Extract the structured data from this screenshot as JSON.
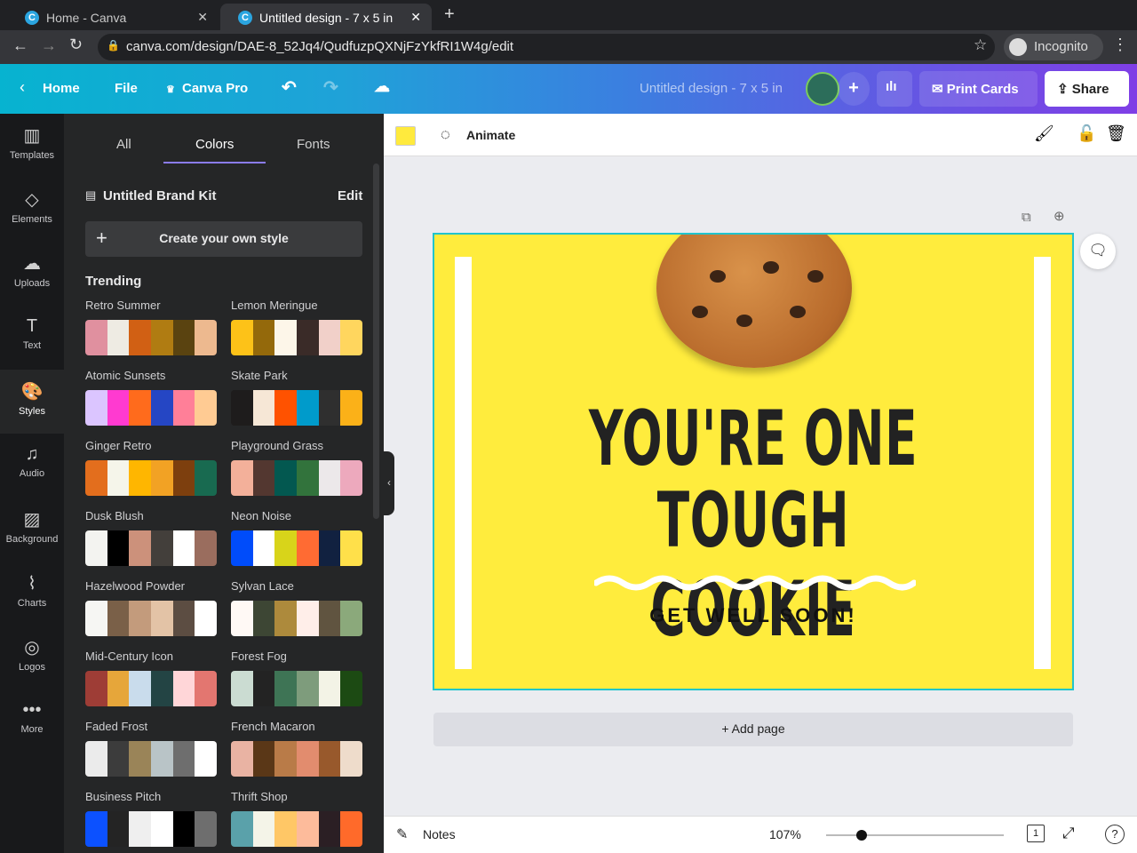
{
  "browser": {
    "tabs": [
      {
        "title": "Home - Canva"
      },
      {
        "title": "Untitled design - 7 x 5 in"
      }
    ],
    "new_tab": "+",
    "url": "canva.com/design/DAE-8_52Jq4/QudfuzpQXNjFzYkfRI1W4g/edit",
    "profile": "Incognito"
  },
  "header": {
    "home": "Home",
    "file": "File",
    "canva_pro": "Canva Pro",
    "design_title": "Untitled design - 7 x 5 in",
    "print": "Print Cards",
    "share": "Share"
  },
  "rail": [
    {
      "label": "Templates",
      "icon": "▥"
    },
    {
      "label": "Elements",
      "icon": "◇"
    },
    {
      "label": "Uploads",
      "icon": "☁"
    },
    {
      "label": "Text",
      "icon": "T"
    },
    {
      "label": "Styles",
      "icon": "🎨"
    },
    {
      "label": "Audio",
      "icon": "♫"
    },
    {
      "label": "Background",
      "icon": "▨"
    },
    {
      "label": "Charts",
      "icon": "⌇"
    },
    {
      "label": "Logos",
      "icon": "◎"
    },
    {
      "label": "More",
      "icon": "•••"
    }
  ],
  "panel": {
    "tabs": [
      "All",
      "Colors",
      "Fonts"
    ],
    "brand_kit": "Untitled Brand Kit",
    "edit": "Edit",
    "create": "Create your own style",
    "section": "Trending",
    "palettes": [
      {
        "name": "Retro Summer",
        "colors": [
          "#e0909f",
          "#eeebe3",
          "#d16014",
          "#b07c12",
          "#5a4310",
          "#edb98f"
        ]
      },
      {
        "name": "Lemon Meringue",
        "colors": [
          "#fdc218",
          "#94690b",
          "#fdf6e9",
          "#3a2b28",
          "#f1d0c9",
          "#ffd65e"
        ]
      },
      {
        "name": "Atomic Sunsets",
        "colors": [
          "#dbc5ff",
          "#ff3ad0",
          "#ff6b1c",
          "#2546c4",
          "#ff7f98",
          "#ffcb93"
        ]
      },
      {
        "name": "Skate Park",
        "colors": [
          "#1e1c1c",
          "#f6e7d6",
          "#ff5200",
          "#009bcb",
          "#2f2f2f",
          "#fbb118"
        ]
      },
      {
        "name": "Ginger Retro",
        "colors": [
          "#e36e1d",
          "#f5f5ea",
          "#ffb600",
          "#f2a224",
          "#7d3f0e",
          "#186a50"
        ]
      },
      {
        "name": "Playground Grass",
        "colors": [
          "#f3b09a",
          "#533730",
          "#035850",
          "#32733c",
          "#ece8ea",
          "#eda9bd"
        ]
      },
      {
        "name": "Dusk Blush",
        "colors": [
          "#f3f3f0",
          "#000000",
          "#cc917b",
          "#433f3b",
          "#ffffff",
          "#9a6d5e"
        ]
      },
      {
        "name": "Neon Noise",
        "colors": [
          "#004cfa",
          "#ffffff",
          "#d8d41a",
          "#ff6b33",
          "#112140",
          "#ffe04a"
        ]
      },
      {
        "name": "Hazelwood Powder",
        "colors": [
          "#f6f6f3",
          "#7a6048",
          "#c39b7c",
          "#e3c3a6",
          "#5c4d42",
          "#ffffff"
        ]
      },
      {
        "name": "Sylvan Lace",
        "colors": [
          "#fff9f5",
          "#3d4634",
          "#ad8a3c",
          "#ffeee9",
          "#605440",
          "#8ba97b"
        ]
      },
      {
        "name": "Mid-Century Icon",
        "colors": [
          "#9e3d36",
          "#e6a63a",
          "#c9dcec",
          "#234444",
          "#ffd6d8",
          "#e37670"
        ]
      },
      {
        "name": "Forest Fog",
        "colors": [
          "#cbdcd2",
          "#232323",
          "#3e7455",
          "#7e9c7c",
          "#f3f3e6",
          "#1c4a13"
        ]
      },
      {
        "name": "Faded Frost",
        "colors": [
          "#ebebeb",
          "#3c3c3c",
          "#9a8458",
          "#b9c4c7",
          "#6e6e6e",
          "#ffffff"
        ]
      },
      {
        "name": "French Macaron",
        "colors": [
          "#e9b3a3",
          "#5a3717",
          "#b97b48",
          "#e28c6e",
          "#98592c",
          "#eedccb"
        ]
      },
      {
        "name": "Business Pitch",
        "colors": [
          "#0c51ff",
          "#242424",
          "#efefef",
          "#ffffff",
          "#000000",
          "#6e6e6e"
        ]
      },
      {
        "name": "Thrift Shop",
        "colors": [
          "#5aa1aa",
          "#f4f4e8",
          "#ffc766",
          "#fdbb9b",
          "#2b1f24",
          "#ff6a2a"
        ]
      }
    ]
  },
  "toolbar": {
    "animate": "Animate",
    "color": "#ffea3d"
  },
  "design": {
    "line1": "YOU'RE ONE",
    "line2": "TOUGH COOKIE",
    "subtitle": "GET WELL SOON!",
    "background": "#ffec3d"
  },
  "add_page": "+ Add page",
  "bottom": {
    "notes": "Notes",
    "zoom": "107%",
    "zoom_fraction": 0.2,
    "page": "1"
  }
}
